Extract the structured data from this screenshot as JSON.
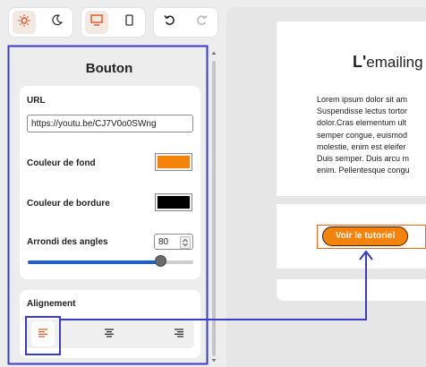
{
  "toolbar": {
    "theme": [
      "sun-icon",
      "moon-icon"
    ],
    "device": [
      "desktop-icon",
      "mobile-icon"
    ],
    "history": [
      "undo-icon",
      "redo-icon"
    ]
  },
  "panel": {
    "title": "Bouton",
    "url_label": "URL",
    "url_value": "https://youtu.be/CJ7V0o0SWng",
    "bg_label": "Couleur de fond",
    "bg_color": "#f5820a",
    "border_label": "Couleur de bordure",
    "border_color": "#000000",
    "radius_label": "Arrondi des angles",
    "radius_value": "80",
    "radius_fraction": 0.8,
    "align_label": "Alignement",
    "align_selected": "left"
  },
  "preview": {
    "title_first": "L'",
    "title_rest": "emailing",
    "body_lines": [
      "Lorem ipsum dolor sit am",
      "Suspendisse lectus tortor",
      "dolor.Cras elementum ult",
      "semper congue, euismod",
      "molestie, enim est eleifer",
      "Duis semper. Duis arcu m",
      "enim. Pellentesque congu"
    ],
    "cta_label": "Voir le tutoriel"
  },
  "colors": {
    "accent": "#f5820a",
    "highlight": "#3b3bc9",
    "slider": "#1a5fd6"
  }
}
